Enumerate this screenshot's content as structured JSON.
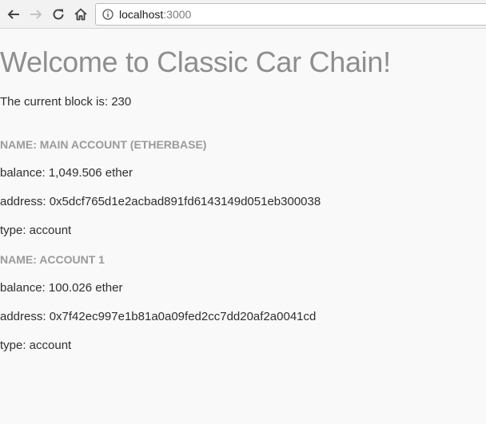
{
  "browser": {
    "url_host": "localhost",
    "url_port": ":3000",
    "icons": [
      "back-arrow-icon",
      "forward-arrow-icon",
      "reload-icon",
      "home-icon",
      "info-icon"
    ]
  },
  "page": {
    "title": "Welcome to Classic Car Chain!",
    "block_text": "The current block is: 230"
  },
  "accounts": [
    {
      "name": "NAME: MAIN ACCOUNT (ETHERBASE)",
      "balance": "balance: 1,049.506 ether",
      "address": "address: 0x5dcf765d1e2acbad891fd6143149d051eb300038",
      "type": "type: account"
    },
    {
      "name": "NAME: ACCOUNT 1",
      "balance": "balance: 100.026 ether",
      "address": "address: 0x7f42ec997e1b81a0a09fed2cc7dd20af2a0041cd",
      "type": "type: account"
    }
  ],
  "colors": {
    "title": "#8e8e8e",
    "account_name": "#9a9a9a",
    "body_text": "#2f2f2f",
    "background": "#f9f9f9"
  }
}
